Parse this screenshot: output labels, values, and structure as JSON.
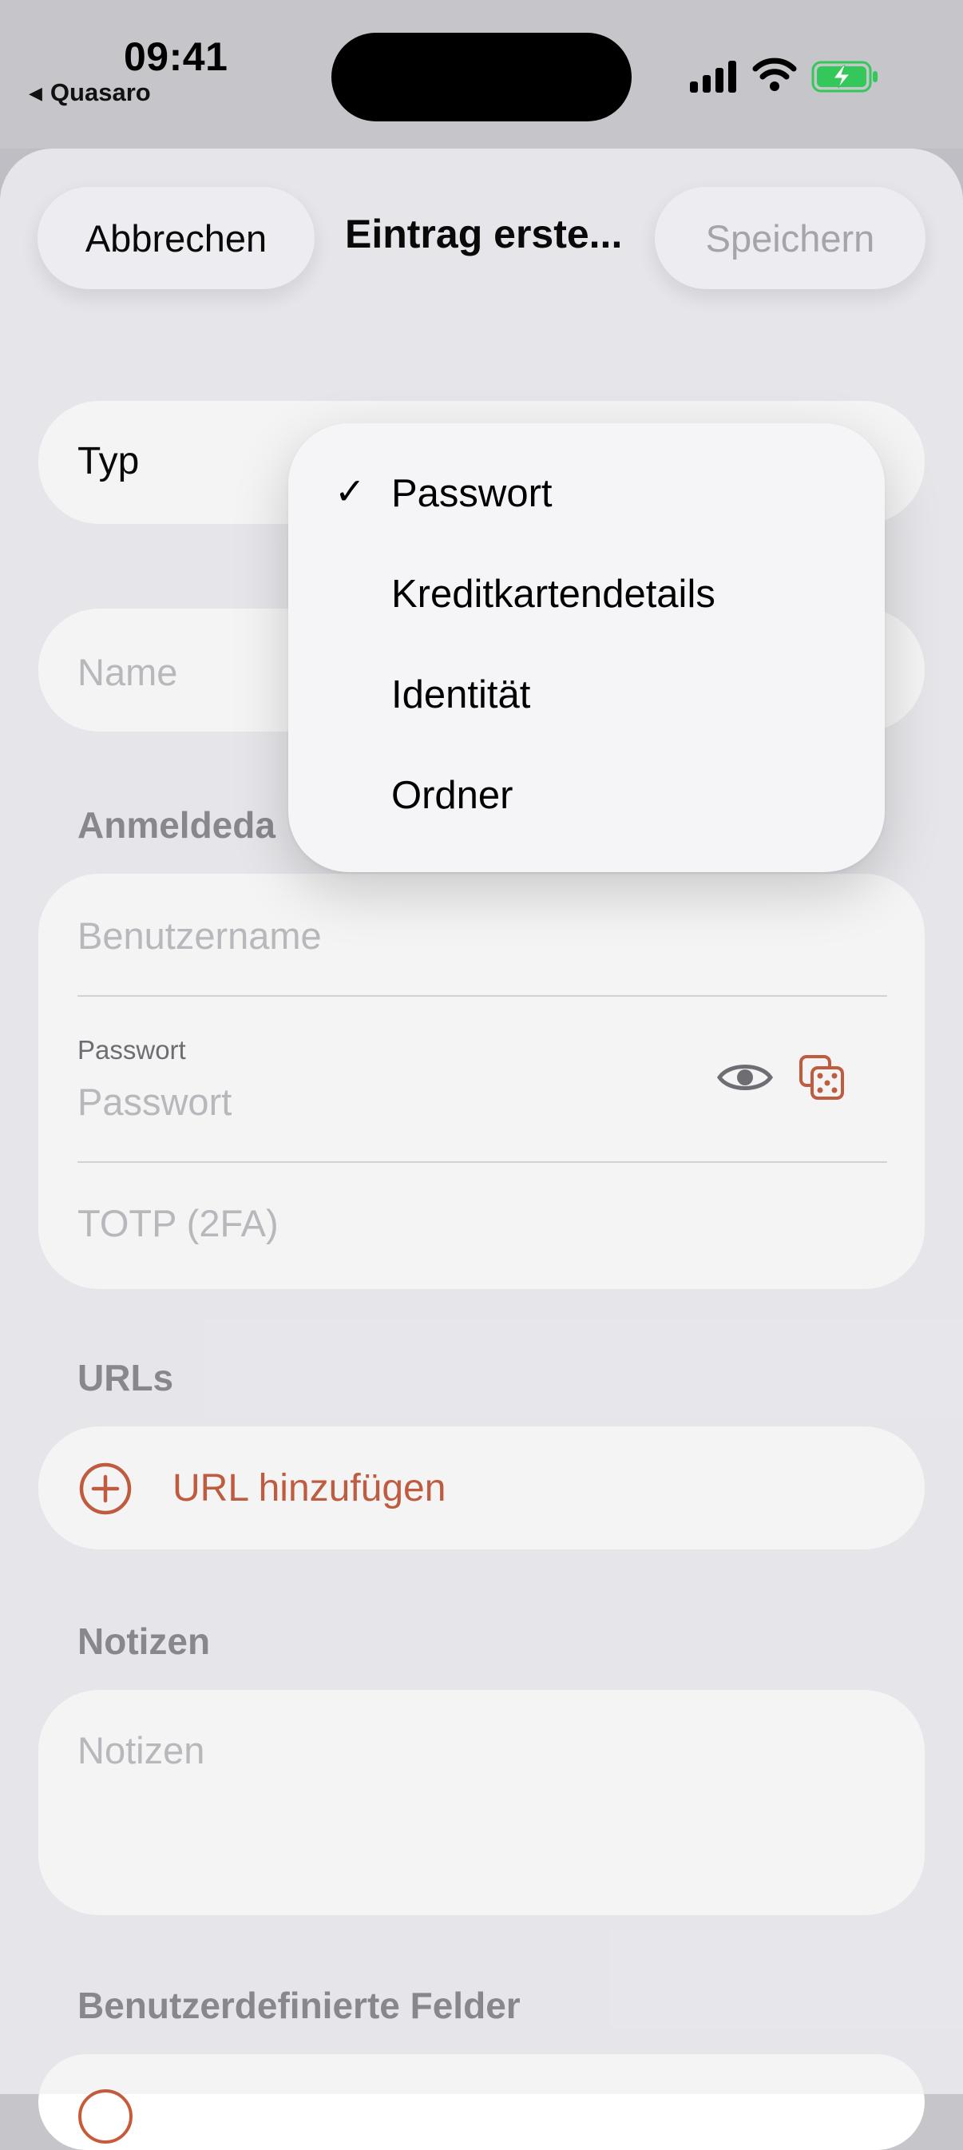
{
  "status_bar": {
    "time": "09:41",
    "back_app": "Quasaro",
    "back_arrow": "◀"
  },
  "nav": {
    "cancel_label": "Abbrechen",
    "title": "Eintrag erste...",
    "save_label": "Speichern"
  },
  "type_row": {
    "label": "Typ"
  },
  "name_field": {
    "placeholder": "Name"
  },
  "login_section": {
    "header": "Anmeldeda",
    "username_placeholder": "Benutzername",
    "password_label": "Passwort",
    "password_placeholder": "Passwort",
    "totp_placeholder": "TOTP (2FA)"
  },
  "urls_section": {
    "header": "URLs",
    "add_label": "URL hinzufügen"
  },
  "notes_section": {
    "header": "Notizen",
    "placeholder": "Notizen"
  },
  "custom_fields_section": {
    "header": "Benutzerdefinierte Felder"
  },
  "type_menu": {
    "check_mark": "✓",
    "items": [
      {
        "label": "Passwort",
        "selected": true
      },
      {
        "label": "Kreditkartendetails",
        "selected": false
      },
      {
        "label": "Identität",
        "selected": false
      },
      {
        "label": "Ordner",
        "selected": false
      }
    ]
  },
  "colors": {
    "accent": "#c65b3b",
    "battery": "#34c759",
    "sheet_bg": "#f0f0f4"
  },
  "icons": {
    "signal": "cellular-signal-icon",
    "wifi": "wifi-icon",
    "battery": "battery-charging-icon",
    "reveal": "eye-icon",
    "generate": "dice-icon",
    "add": "plus-circle-icon"
  }
}
